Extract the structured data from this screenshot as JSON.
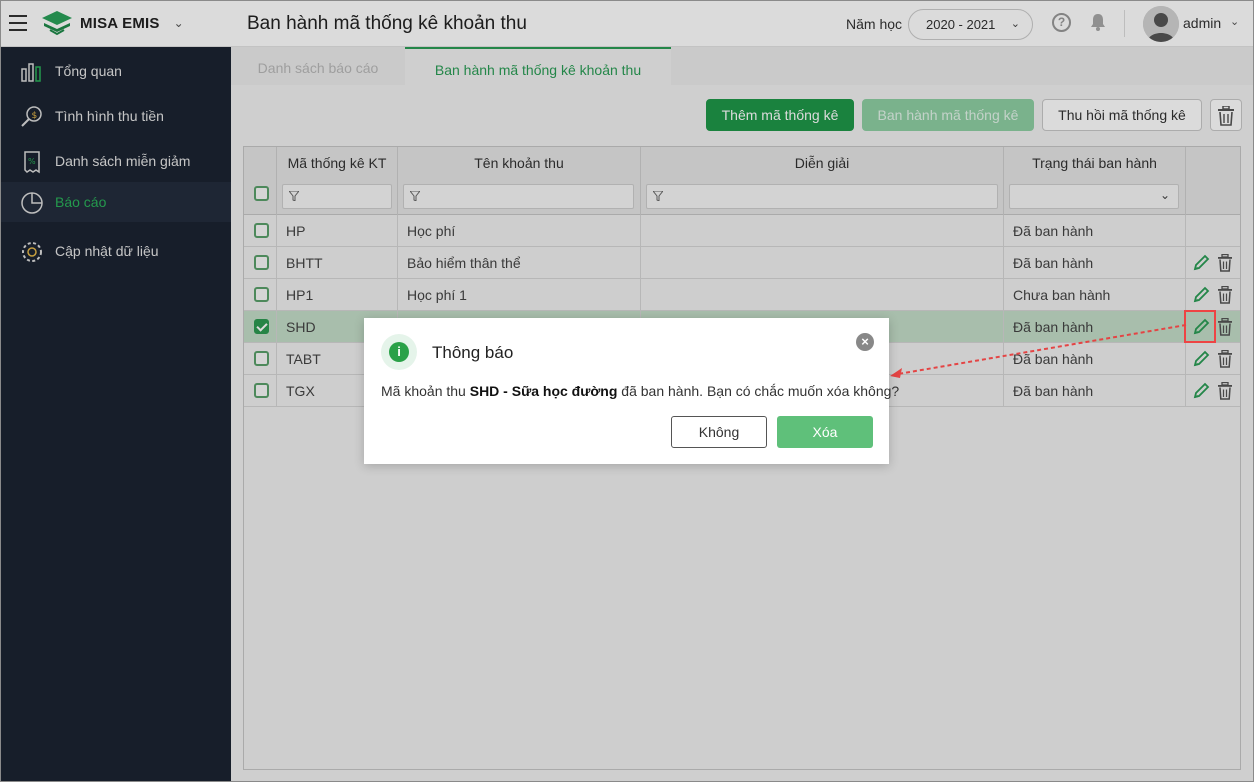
{
  "header": {
    "app_name": "MISA EMIS",
    "page_title": "Ban hành mã thống kê khoản thu",
    "year_label": "Năm học",
    "year_value": "2020 - 2021",
    "user_name": "admin"
  },
  "sidebar": {
    "items": [
      {
        "label": "Tổng quan",
        "icon": "chart-bars-icon"
      },
      {
        "label": "Tình hình thu tiền",
        "icon": "money-search-icon"
      },
      {
        "label": "Danh sách miễn giảm",
        "icon": "discount-receipt-icon"
      },
      {
        "label": "Báo cáo",
        "icon": "pie-chart-icon",
        "active": true
      },
      {
        "label": "Cập nhật dữ liệu",
        "icon": "gear-icon"
      }
    ],
    "active_color": "#2bb35a"
  },
  "tabs": [
    {
      "label": "Danh sách báo cáo"
    },
    {
      "label": "Ban hành mã thống kê khoản thu",
      "active": true
    }
  ],
  "toolbar": {
    "add_label": "Thêm mã thống kê",
    "publish_label": "Ban hành mã thống kê",
    "revoke_label": "Thu hồi mã thống kê"
  },
  "table": {
    "columns": [
      "Mã thống kê KT",
      "Tên khoản thu",
      "Diễn giải",
      "Trạng thái ban hành"
    ],
    "rows": [
      {
        "code": "HP",
        "name": "Học phí",
        "desc": "",
        "status": "Đã ban hành",
        "checked": false,
        "actions": false
      },
      {
        "code": "BHTT",
        "name": "Bảo hiểm thân thể",
        "desc": "",
        "status": "Đã ban hành",
        "checked": false,
        "actions": true
      },
      {
        "code": "HP1",
        "name": "Học phí 1",
        "desc": "",
        "status": "Chưa ban hành",
        "checked": false,
        "actions": true
      },
      {
        "code": "SHD",
        "name": "",
        "desc": "",
        "status": "Đã ban hành",
        "checked": true,
        "actions": true
      },
      {
        "code": "TABT",
        "name": "",
        "desc": "",
        "status": "Đã ban hành",
        "checked": false,
        "actions": true
      },
      {
        "code": "TGX",
        "name": "",
        "desc": "",
        "status": "Đã ban hành",
        "checked": false,
        "actions": true
      }
    ]
  },
  "dialog": {
    "title": "Thông báo",
    "msg_prefix": "Mã khoản thu ",
    "msg_bold": "SHD - Sữa học đường",
    "msg_suffix": " đã ban hành. Bạn có chắc muốn xóa không?",
    "no_label": "Không",
    "yes_label": "Xóa"
  },
  "colors": {
    "brand_green": "#1f9849",
    "sidebar_bg": "#1b2432",
    "annotation_red": "#e44444"
  }
}
